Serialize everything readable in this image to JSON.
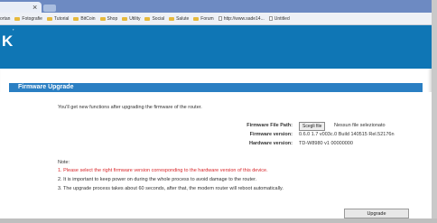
{
  "browser": {
    "tab_close": "×",
    "bookmarks": [
      {
        "label": "ortan",
        "icon": "none"
      },
      {
        "label": "Fotografie",
        "icon": "folder-icon"
      },
      {
        "label": "Tutorial",
        "icon": "folder-icon"
      },
      {
        "label": "BitCoin",
        "icon": "folder-icon"
      },
      {
        "label": "Shop",
        "icon": "folder-icon"
      },
      {
        "label": "Utility",
        "icon": "folder-icon"
      },
      {
        "label": "Social",
        "icon": "folder-icon"
      },
      {
        "label": "Salute",
        "icon": "folder-icon"
      },
      {
        "label": "Forum",
        "icon": "folder-icon"
      },
      {
        "label": "http://www.sade14...",
        "icon": "page-icon"
      },
      {
        "label": "Untitled",
        "icon": "page-icon"
      }
    ]
  },
  "router": {
    "logo": "K",
    "logo_mark": "’",
    "brand_color": "#0f76b5",
    "section_title": "Firmware Upgrade",
    "intro": "You'll get new functions after upgrading the firmware of the router.",
    "fields": {
      "file_path_label": "Firmware File Path:",
      "browse_label": "Scegli file",
      "browse_status": "Nessun file selezionato",
      "firmware_label": "Firmware version:",
      "firmware_value": "0.6.0 1.7 v003c.0 Build 140515 Rel.52176n",
      "hardware_label": "Hardware version:",
      "hardware_value": "TD-W8980 v1 00000000"
    },
    "notes": {
      "label": "Note:",
      "items": [
        "1. Please select the right firmware version corresponding to the hardware version of this device.",
        "2. It is important to keep power on during the whole process to avoid damage to the router.",
        "3. The upgrade process takes about 60 seconds, after that, the modem router will reboot automatically."
      ]
    },
    "upgrade_label": "Upgrade",
    "warning_color": "#d9262a"
  }
}
